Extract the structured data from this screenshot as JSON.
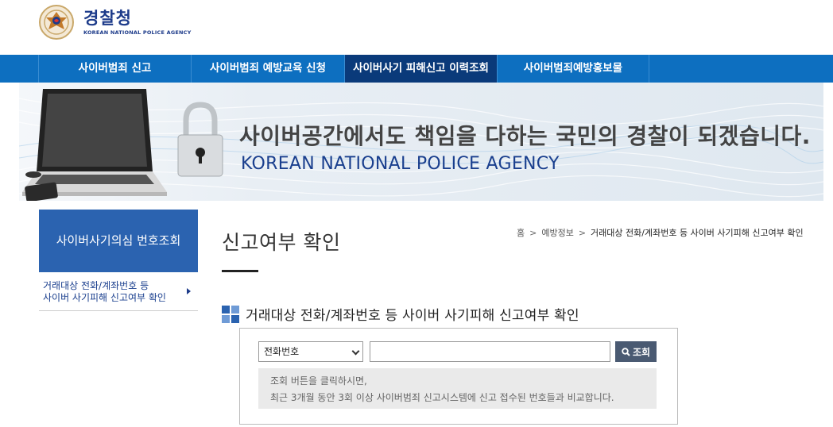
{
  "header": {
    "logo_kr": "경찰청",
    "logo_en": "KOREAN NATIONAL POLICE AGENCY"
  },
  "nav": {
    "items": [
      {
        "label": "사이버범죄 신고"
      },
      {
        "label": "사이버범죄 예방교육 신청"
      },
      {
        "label": "사이버사기 피해신고 이력조회",
        "active": true
      },
      {
        "label": "사이버범죄예방홍보물"
      }
    ]
  },
  "banner": {
    "headline": "사이버공간에서도 책임을 다하는 국민의 경찰이 되겠습니다.",
    "subline": "KOREAN NATIONAL POLICE AGENCY"
  },
  "sidebar": {
    "title": "사이버사기의심 번호조회",
    "items": [
      {
        "line1": "거래대상 전화/계좌번호 등",
        "line2": "사이버 사기피해 신고여부 확인"
      }
    ]
  },
  "main": {
    "page_title": "신고여부 확인",
    "breadcrumb": {
      "home": "홈",
      "level1": "예방정보",
      "current": "거래대상 전화/계좌번호 등 사이버 사기피해 신고여부 확인"
    },
    "section_title": "거래대상 전화/계좌번호 등 사이버 사기피해 신고여부 확인",
    "form": {
      "select_value": "전화번호",
      "input_value": "",
      "search_label": "조회",
      "info_line1": "조회 버튼을 클릭하시면,",
      "info_line2": "최근 3개월 동안 3회 이상 사이버범죄 신고시스템에 신고 접수된 번호들과 비교합니다."
    }
  },
  "colors": {
    "nav_bg": "#0d6fc0",
    "nav_active": "#0a3a7a",
    "sidebar_title_bg": "#2b63b0",
    "brand_navy": "#1d3b8a",
    "search_button": "#4a5a72"
  }
}
